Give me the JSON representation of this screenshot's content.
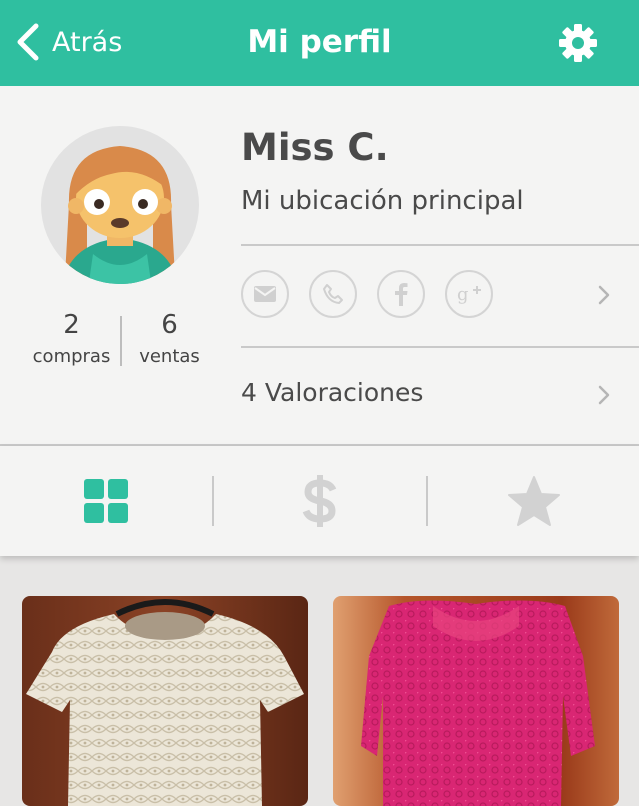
{
  "header": {
    "back_label": "Atrás",
    "title": "Mi perfil"
  },
  "profile": {
    "name": "Miss C.",
    "location": "Mi ubicación principal",
    "stats": [
      {
        "value": "2",
        "label": "compras"
      },
      {
        "value": "6",
        "label": "ventas"
      }
    ],
    "contact_icons": [
      "mail-icon",
      "phone-icon",
      "facebook-icon",
      "google-plus-icon"
    ],
    "ratings_label": "4 Valoraciones"
  },
  "tabs": [
    {
      "icon": "grid-icon",
      "active": true
    },
    {
      "icon": "dollar-icon",
      "active": false
    },
    {
      "icon": "star-icon",
      "active": false
    }
  ],
  "products": [
    {
      "name": "white-lace-dress"
    },
    {
      "name": "pink-lace-dress"
    }
  ],
  "colors": {
    "accent": "#2fbfa0",
    "inactive_icon": "#cfcfcf"
  }
}
